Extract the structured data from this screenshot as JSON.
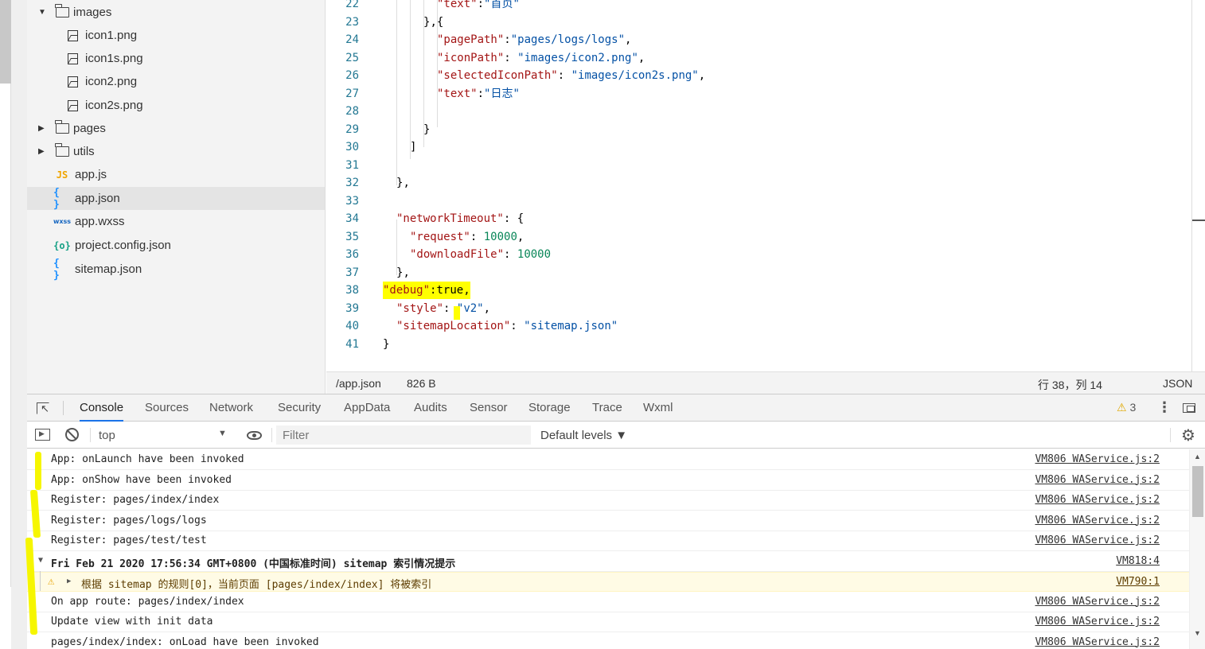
{
  "file_tree": {
    "items": [
      {
        "label": "images",
        "type": "folder",
        "expanded": true,
        "depth": 0
      },
      {
        "label": "icon1.png",
        "type": "image",
        "depth": 1
      },
      {
        "label": "icon1s.png",
        "type": "image",
        "depth": 1
      },
      {
        "label": "icon2.png",
        "type": "image",
        "depth": 1
      },
      {
        "label": "icon2s.png",
        "type": "image",
        "depth": 1
      },
      {
        "label": "pages",
        "type": "folder",
        "expanded": false,
        "depth": 0
      },
      {
        "label": "utils",
        "type": "folder",
        "expanded": false,
        "depth": 0
      },
      {
        "label": "app.js",
        "type": "js",
        "depth": 0
      },
      {
        "label": "app.json",
        "type": "json",
        "depth": 0,
        "active": true
      },
      {
        "label": "app.wxss",
        "type": "wxss",
        "depth": 0
      },
      {
        "label": "project.config.json",
        "type": "config",
        "depth": 0
      },
      {
        "label": "sitemap.json",
        "type": "json",
        "depth": 0
      }
    ]
  },
  "editor": {
    "lines": [
      {
        "n": "22",
        "text": "\"text\":\"首页\""
      },
      {
        "n": "23",
        "text": "},{"
      },
      {
        "n": "24",
        "text": "\"pagePath\":\"pages/logs/logs\","
      },
      {
        "n": "25",
        "text": "\"iconPath\": \"images/icon2.png\","
      },
      {
        "n": "26",
        "text": "\"selectedIconPath\": \"images/icon2s.png\","
      },
      {
        "n": "27",
        "text": "\"text\":\"日志\""
      },
      {
        "n": "28",
        "text": ""
      },
      {
        "n": "29",
        "text": "}"
      },
      {
        "n": "30",
        "text": "]"
      },
      {
        "n": "31",
        "text": ""
      },
      {
        "n": "32",
        "text": "},"
      },
      {
        "n": "33",
        "text": ""
      },
      {
        "n": "34",
        "text": "\"networkTimeout\": {"
      },
      {
        "n": "35",
        "text": "\"request\": 10000,"
      },
      {
        "n": "36",
        "text": "\"downloadFile\": 10000"
      },
      {
        "n": "37",
        "text": "},"
      },
      {
        "n": "38",
        "text": "\"debug\":true,"
      },
      {
        "n": "39",
        "text": "\"style\": \"v2\","
      },
      {
        "n": "40",
        "text": "\"sitemapLocation\": \"sitemap.json\""
      },
      {
        "n": "41",
        "text": "}"
      }
    ]
  },
  "statusbar": {
    "file": "/app.json",
    "size": "826 B",
    "position": "行 38，列 14",
    "language": "JSON"
  },
  "devtools": {
    "tabs": [
      "Console",
      "Sources",
      "Network",
      "Security",
      "AppData",
      "Audits",
      "Sensor",
      "Storage",
      "Trace",
      "Wxml"
    ],
    "active_tab": "Console",
    "warning_count": "3",
    "context": "top",
    "filter_placeholder": "Filter",
    "levels": "Default levels ▼",
    "console": [
      {
        "msg": "App: onLaunch have been invoked",
        "src": "VM806 WAService.js:2"
      },
      {
        "msg": "App: onShow have been invoked",
        "src": "VM806 WAService.js:2"
      },
      {
        "msg": "Register: pages/index/index",
        "src": "VM806 WAService.js:2"
      },
      {
        "msg": "Register: pages/logs/logs",
        "src": "VM806 WAService.js:2"
      },
      {
        "msg": "Register: pages/test/test",
        "src": "VM806 WAService.js:2"
      },
      {
        "msg": "Fri Feb 21 2020 17:56:34 GMT+0800 (中国标准时间) sitemap 索引情况提示",
        "src": "VM818:4",
        "kind": "group"
      },
      {
        "msg": "根据 sitemap 的规则[0]，当前页面 [pages/index/index] 将被索引",
        "src": "VM790:1",
        "kind": "warn"
      },
      {
        "msg": "On app route: pages/index/index",
        "src": "VM806 WAService.js:2"
      },
      {
        "msg": "Update view with init data",
        "src": "VM806 WAService.js:2"
      },
      {
        "msg": "pages/index/index: onLoad have been invoked",
        "src": "VM806 WAService.js:2"
      }
    ]
  },
  "colors": {
    "highlight": "#ffff00",
    "accent": "#1a73e8",
    "warning": "#e8a200"
  }
}
